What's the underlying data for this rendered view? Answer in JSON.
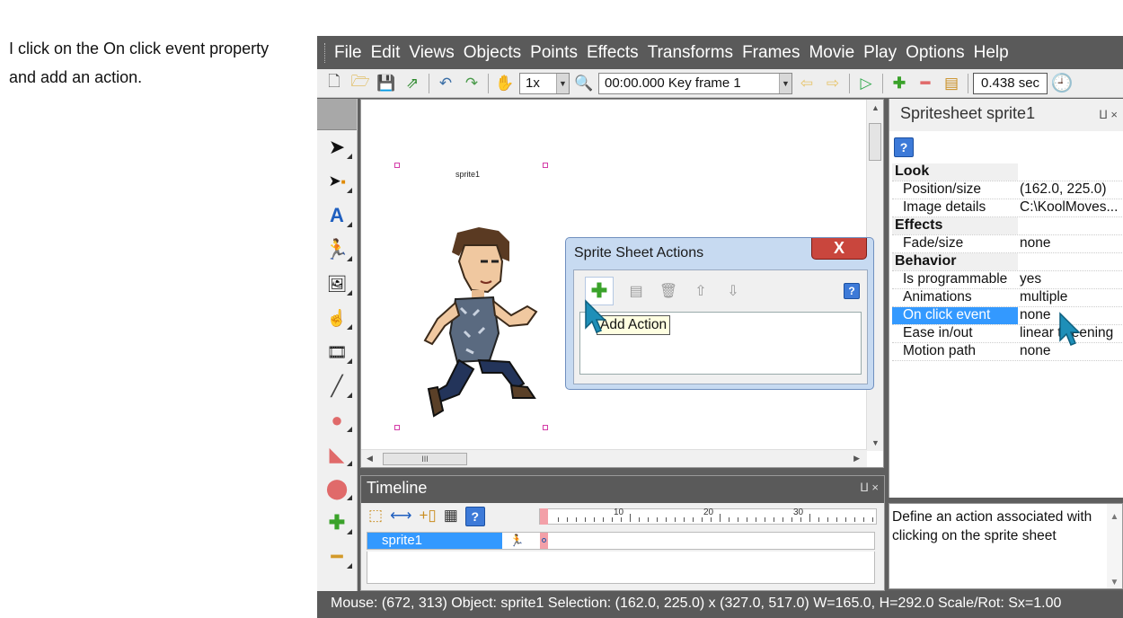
{
  "instruction": {
    "line1": "I click on the On click event property",
    "line2": "and add an action."
  },
  "menu": [
    "File",
    "Edit",
    "Views",
    "Objects",
    "Points",
    "Effects",
    "Transforms",
    "Frames",
    "Movie",
    "Play",
    "Options",
    "Help"
  ],
  "toolbar": {
    "zoom": "1x",
    "keyframe": "00:00.000  Key frame 1",
    "time": "0.438 sec"
  },
  "stage": {
    "sprite_label": "sprite1"
  },
  "timeline": {
    "title": "Timeline",
    "pins": "⨿ ×",
    "track_name": "sprite1",
    "ruler_marks": [
      "10",
      "20",
      "30"
    ]
  },
  "properties": {
    "title": "Spritesheet sprite1",
    "pins": "⨿ ×",
    "rows": [
      {
        "k": "Look",
        "v": "",
        "cat": true
      },
      {
        "k": "Position/size",
        "v": "(162.0, 225.0)"
      },
      {
        "k": "Image details",
        "v": "C:\\KoolMoves..."
      },
      {
        "k": "Effects",
        "v": "",
        "cat": true
      },
      {
        "k": "Fade/size",
        "v": "none"
      },
      {
        "k": "Behavior",
        "v": "",
        "cat": true
      },
      {
        "k": "Is programmable",
        "v": "yes"
      },
      {
        "k": "Animations",
        "v": "multiple"
      },
      {
        "k": "On click event",
        "v": "none",
        "sel": true
      },
      {
        "k": "Ease in/out",
        "v": "linear tweening"
      },
      {
        "k": "Motion path",
        "v": "none"
      }
    ],
    "description": "Define an action associated with clicking on the sprite sheet"
  },
  "dialog": {
    "title": "Sprite Sheet Actions",
    "close": "X",
    "tooltip": "Add Action"
  },
  "status": "Mouse: (672, 313)  Object: sprite1  Selection: (162.0, 225.0) x (327.0, 517.0)  W=165.0,  H=292.0  Scale/Rot: Sx=1.00",
  "colors": {
    "accent": "#3399ff",
    "cursor": "#1e8fb8",
    "darkbar": "#5a5a5a"
  }
}
